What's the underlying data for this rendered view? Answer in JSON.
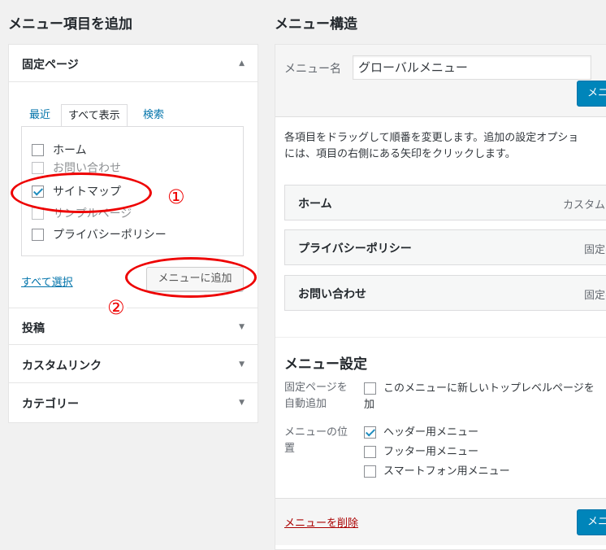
{
  "left": {
    "title": "メニュー項目を追加",
    "accordion": {
      "pages": {
        "label": "固定ページ",
        "arrow": "▲",
        "tabs": [
          "最近",
          "すべて表示",
          "検索"
        ],
        "items": [
          {
            "label": "ホーム",
            "checked": false
          },
          {
            "label": "お問い合わせ",
            "checked": false
          },
          {
            "label": "サイトマップ",
            "checked": true
          },
          {
            "label": "サンプルページ",
            "checked": false
          },
          {
            "label": "プライバシーポリシー",
            "checked": false
          }
        ],
        "select_all": "すべて選択",
        "add_button": "メニューに追加"
      },
      "sections": [
        {
          "label": "投稿",
          "arrow": "▼"
        },
        {
          "label": "カスタムリンク",
          "arrow": "▼"
        },
        {
          "label": "カテゴリー",
          "arrow": "▼"
        }
      ]
    }
  },
  "right": {
    "title": "メニュー構造",
    "menu_name_label": "メニュー名",
    "menu_name_value": "グローバルメニュー",
    "save_button": "メニ",
    "instructions_line1": "各項目をドラッグして順番を変更します。追加の設定オプショ",
    "instructions_line2": "には、項目の右側にある矢印をクリックします。",
    "menu_items": [
      {
        "title": "ホーム",
        "type": "カスタム"
      },
      {
        "title": "プライバシーポリシー",
        "type": "固定ペ"
      },
      {
        "title": "お問い合わせ",
        "type": "固定ペ"
      }
    ],
    "settings": {
      "title": "メニュー設定",
      "auto_add_label_1": "固定ページを",
      "auto_add_label_2": "自動追加",
      "auto_add_text_1": "このメニューに新しいトップレベルページを",
      "auto_add_text_2": "加",
      "location_label_1": "メニューの位",
      "location_label_2": "置",
      "locations": [
        {
          "label": "ヘッダー用メニュー",
          "checked": true
        },
        {
          "label": "フッター用メニュー",
          "checked": false
        },
        {
          "label": "スマートフォン用メニュー",
          "checked": false
        }
      ]
    },
    "delete_link": "メニューを削除",
    "save_button_bottom": "メニ"
  },
  "annotations": {
    "one": "①",
    "two": "②",
    "color": "#e00000"
  }
}
